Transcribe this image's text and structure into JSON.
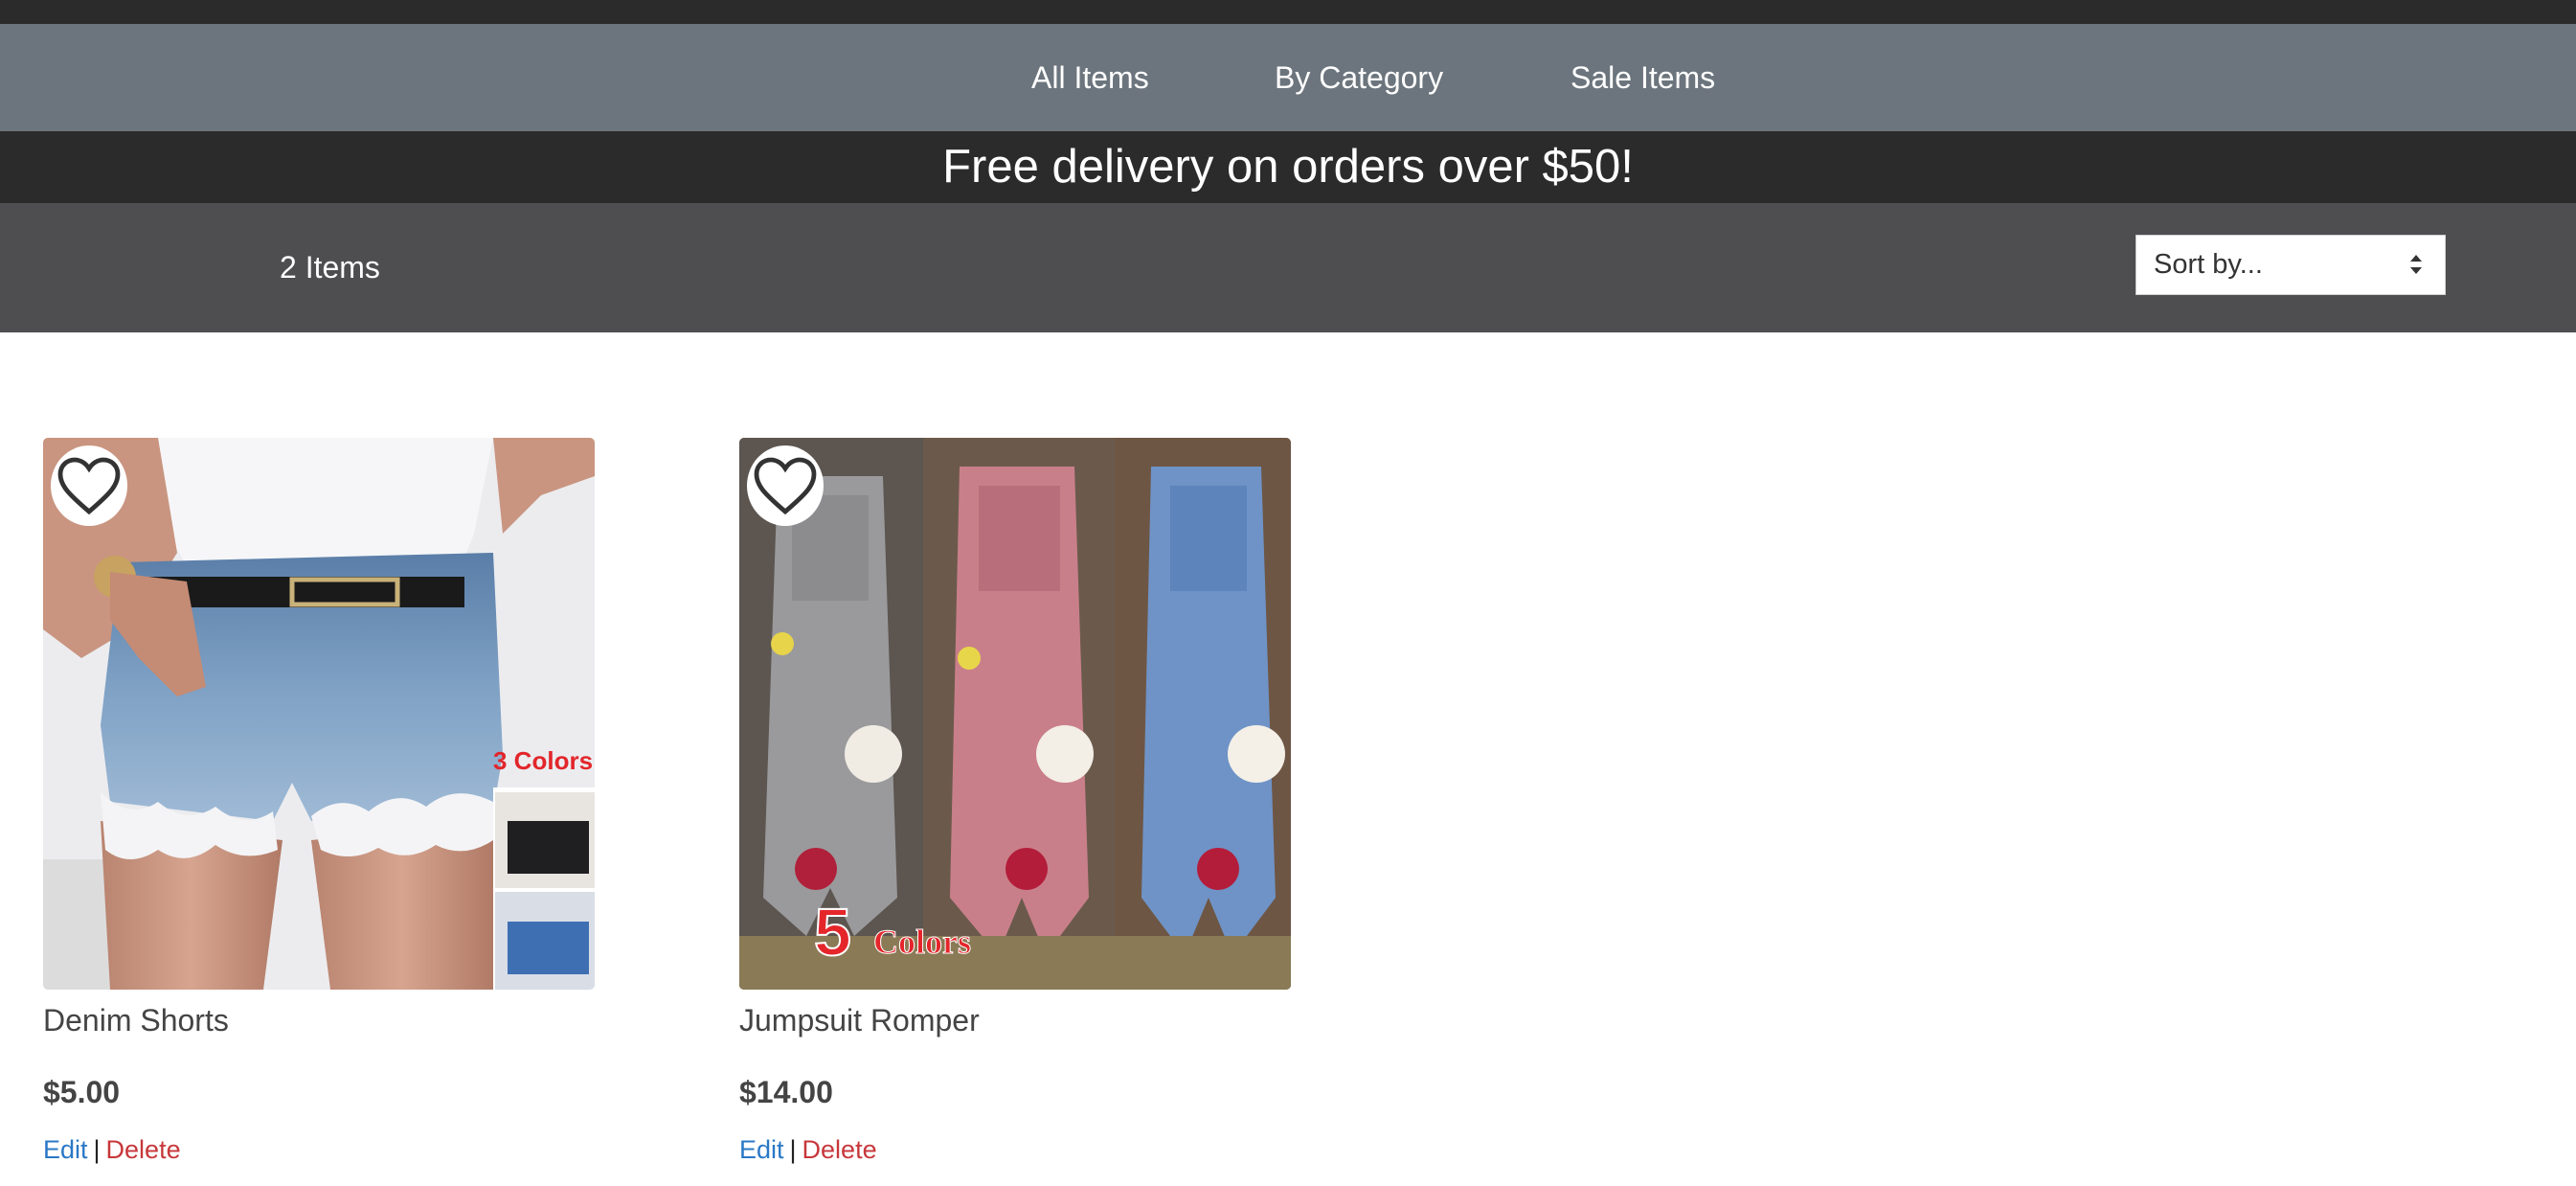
{
  "nav": {
    "items": [
      {
        "label": "All Items"
      },
      {
        "label": "By Category"
      },
      {
        "label": "Sale Items"
      }
    ]
  },
  "promo": {
    "text": "Free delivery on orders over $50!"
  },
  "toolbar": {
    "item_count": "2 Items",
    "sort": {
      "selected": "Sort by...",
      "icon": "sort-arrows-icon"
    }
  },
  "products": [
    {
      "name": "Denim Shorts",
      "price": "$5.00",
      "image_badge": "3 Colors",
      "favorite_icon": "heart-outline-icon",
      "actions": {
        "edit": "Edit",
        "separator": "|",
        "delete": "Delete"
      }
    },
    {
      "name": "Jumpsuit Romper",
      "price": "$14.00",
      "image_badge_number": "5",
      "image_badge_text": "Colors",
      "favorite_icon": "heart-outline-icon",
      "actions": {
        "edit": "Edit",
        "separator": "|",
        "delete": "Delete"
      }
    }
  ],
  "colors": {
    "nav_bg": "#6c757d",
    "dark_bar": "#2b2b2b",
    "toolbar_bg": "#4e4d4f",
    "edit_link": "#2a78c6",
    "delete_link": "#c7373b"
  }
}
